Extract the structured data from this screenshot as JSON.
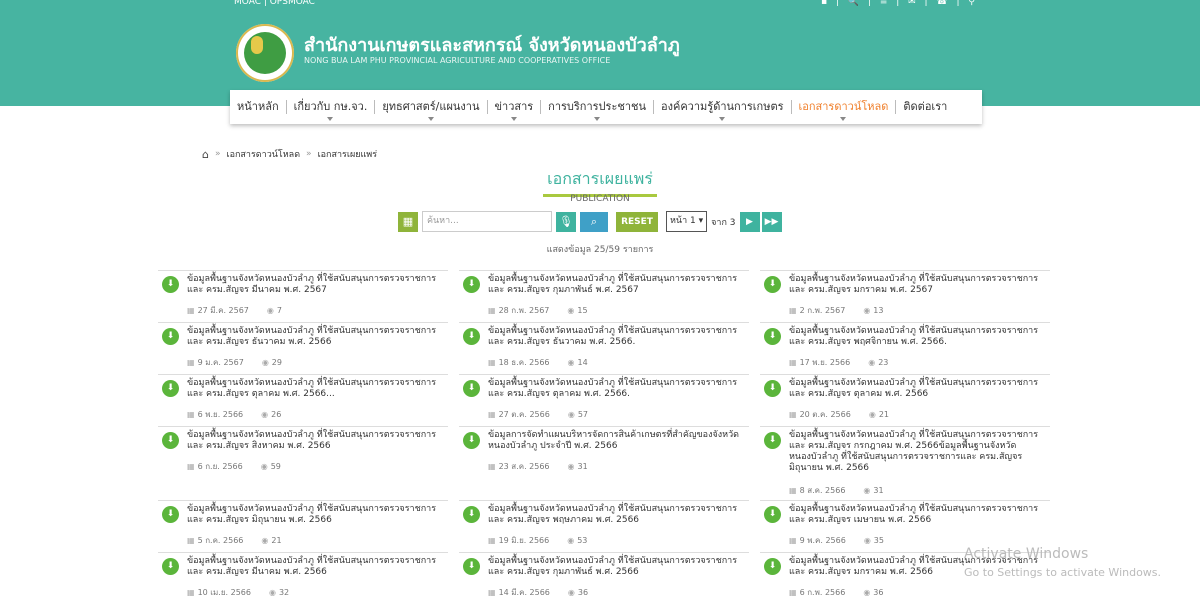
{
  "header": {
    "top_left": "MOAC  |  OPSMOAC",
    "top_right": "▪  |  🔍  |  ≡  |  ✉  |  ☎  |  ⚲",
    "org_th": "สำนักงานเกษตรและสหกรณ์ จังหวัดหนองบัวลำภู",
    "org_en": "NONG BUA LAM PHU PROVINCIAL AGRICULTURE AND COOPERATIVES OFFICE"
  },
  "nav": [
    {
      "label": "หน้าหลัก",
      "caret": false,
      "active": false
    },
    {
      "label": "เกี่ยวกับ กษ.จว.",
      "caret": true,
      "active": false
    },
    {
      "label": "ยุทธศาสตร์/แผนงาน",
      "caret": true,
      "active": false
    },
    {
      "label": "ข่าวสาร",
      "caret": true,
      "active": false
    },
    {
      "label": "การบริการประชาชน",
      "caret": true,
      "active": false
    },
    {
      "label": "องค์ความรู้ด้านการเกษตร",
      "caret": true,
      "active": false
    },
    {
      "label": "เอกสารดาวน์โหลด",
      "caret": true,
      "active": true
    },
    {
      "label": "ติดต่อเรา",
      "caret": false,
      "active": false
    }
  ],
  "breadcrumb": [
    "เอกสารดาวน์โหลด",
    "เอกสารเผยแพร่"
  ],
  "page": {
    "title": "เอกสารเผยแพร่",
    "subtitle": "PUBLICATION",
    "search_placeholder": "ค้นหา...",
    "reset_label": "RESET",
    "page_select": "หน้า 1",
    "page_of": "จาก 3",
    "count_text": "แสดงข้อมูล 25/59 รายการ"
  },
  "colors": {
    "accent": "#47b4a1",
    "green": "#8fb43a",
    "active_nav": "#f07f2a"
  },
  "items": [
    {
      "title": "ข้อมูลพื้นฐานจังหวัดหนองบัวลำภู ที่ใช้สนับสนุนการตรวจราชการและ ครม.สัญจร มีนาคม พ.ศ. 2567",
      "date": "27 มี.ค. 2567",
      "views": "7"
    },
    {
      "title": "ข้อมูลพื้นฐานจังหวัดหนองบัวลำภู ที่ใช้สนับสนุนการตรวจราชการและ ครม.สัญจร กุมภาพันธ์ พ.ศ. 2567",
      "date": "28 ก.พ. 2567",
      "views": "15"
    },
    {
      "title": "ข้อมูลพื้นฐานจังหวัดหนองบัวลำภู ที่ใช้สนับสนุนการตรวจราชการและ ครม.สัญจร มกราคม พ.ศ. 2567",
      "date": "2 ก.พ. 2567",
      "views": "13"
    },
    {
      "title": "ข้อมูลพื้นฐานจังหวัดหนองบัวลำภู ที่ใช้สนับสนุนการตรวจราชการและ ครม.สัญจร ธันวาคม พ.ศ. 2566",
      "date": "9 ม.ค. 2567",
      "views": "29"
    },
    {
      "title": "ข้อมูลพื้นฐานจังหวัดหนองบัวลำภู ที่ใช้สนับสนุนการตรวจราชการและ ครม.สัญจร ธันวาคม พ.ศ. 2566.",
      "date": "18 ธ.ค. 2566",
      "views": "14"
    },
    {
      "title": "ข้อมูลพื้นฐานจังหวัดหนองบัวลำภู ที่ใช้สนับสนุนการตรวจราชการและ ครม.สัญจร พฤศจิกายน พ.ศ. 2566.",
      "date": "17 พ.ย. 2566",
      "views": "23"
    },
    {
      "title": "ข้อมูลพื้นฐานจังหวัดหนองบัวลำภู ที่ใช้สนับสนุนการตรวจราชการและ ครม.สัญจร ตุลาคม พ.ศ. 2566...",
      "date": "6 พ.ย. 2566",
      "views": "26"
    },
    {
      "title": "ข้อมูลพื้นฐานจังหวัดหนองบัวลำภู ที่ใช้สนับสนุนการตรวจราชการและ ครม.สัญจร ตุลาคม พ.ศ. 2566.",
      "date": "27 ต.ค. 2566",
      "views": "57"
    },
    {
      "title": "ข้อมูลพื้นฐานจังหวัดหนองบัวลำภู ที่ใช้สนับสนุนการตรวจราชการและ ครม.สัญจร ตุลาคม พ.ศ. 2566",
      "date": "20 ต.ค. 2566",
      "views": "21"
    },
    {
      "title": "ข้อมูลพื้นฐานจังหวัดหนองบัวลำภู ที่ใช้สนับสนุนการตรวจราชการและ ครม.สัญจร สิงหาคม พ.ศ. 2566",
      "date": "6 ก.ย. 2566",
      "views": "59"
    },
    {
      "title": "ข้อมูลการจัดทำแผนบริหารจัดการสินค้าเกษตรที่สำคัญของจังหวัดหนองบัวลำภู ประจำปี พ.ศ. 2566",
      "date": "23 ส.ค. 2566",
      "views": "31"
    },
    {
      "title": "ข้อมูลพื้นฐานจังหวัดหนองบัวลำภู ที่ใช้สนับสนุนการตรวจราชการและ ครม.สัญจร กรกฎาคม พ.ศ. 2566ข้อมูลพื้นฐานจังหวัดหนองบัวลำภู ที่ใช้สนับสนุนการตรวจราชการและ ครม.สัญจร มิถุนายน พ.ศ. 2566",
      "date": "8 ส.ค. 2566",
      "views": "31"
    },
    {
      "title": "ข้อมูลพื้นฐานจังหวัดหนองบัวลำภู ที่ใช้สนับสนุนการตรวจราชการและ ครม.สัญจร มิถุนายน พ.ศ. 2566",
      "date": "5 ก.ค. 2566",
      "views": "21"
    },
    {
      "title": "ข้อมูลพื้นฐานจังหวัดหนองบัวลำภู ที่ใช้สนับสนุนการตรวจราชการและ ครม.สัญจร พฤษภาคม พ.ศ. 2566",
      "date": "19 มิ.ย. 2566",
      "views": "53"
    },
    {
      "title": "ข้อมูลพื้นฐานจังหวัดหนองบัวลำภู ที่ใช้สนับสนุนการตรวจราชการและ ครม.สัญจร เมษายน พ.ศ. 2566",
      "date": "9 พ.ค. 2566",
      "views": "35"
    },
    {
      "title": "ข้อมูลพื้นฐานจังหวัดหนองบัวลำภู ที่ใช้สนับสนุนการตรวจราชการและ ครม.สัญจร มีนาคม พ.ศ. 2566",
      "date": "10 เม.ย. 2566",
      "views": "32"
    },
    {
      "title": "ข้อมูลพื้นฐานจังหวัดหนองบัวลำภู ที่ใช้สนับสนุนการตรวจราชการและ ครม.สัญจร กุมภาพันธ์ พ.ศ. 2566",
      "date": "14 มี.ค. 2566",
      "views": "36"
    },
    {
      "title": "ข้อมูลพื้นฐานจังหวัดหนองบัวลำภู ที่ใช้สนับสนุนการตรวจราชการและ ครม.สัญจร มกราคม พ.ศ. 2566",
      "date": "6 ก.พ. 2566",
      "views": "36"
    }
  ],
  "watermark": {
    "line1": "Activate Windows",
    "line2": "Go to Settings to activate Windows."
  }
}
